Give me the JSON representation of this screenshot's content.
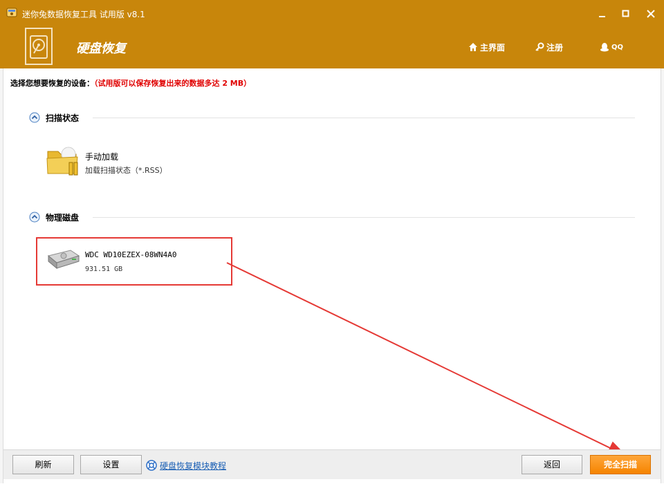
{
  "window": {
    "title": "迷你兔数据恢复工具 试用版 v8.1"
  },
  "header": {
    "title": "硬盘恢复",
    "nav": {
      "home": "主界面",
      "register": "注册",
      "qq": "QQ"
    }
  },
  "prompt": {
    "text": "选择您想要恢复的设备：",
    "note": "（试用版可以保存恢复出来的数据多达 2 MB）"
  },
  "scan_state": {
    "label": "扫描状态",
    "items": [
      {
        "name": "手动加载",
        "sub": "加载扫描状态（*.RSS）"
      }
    ]
  },
  "physical_disks": {
    "label": "物理磁盘",
    "items": [
      {
        "name": "WDC WD10EZEX-08WN4A0",
        "sub": "931.51 GB"
      }
    ]
  },
  "footer": {
    "refresh": "刷新",
    "settings": "设置",
    "tutorial_link": "硬盘恢复模块教程",
    "back": "返回",
    "full_scan": "完全扫描"
  },
  "colors": {
    "header_bg": "#c8860b",
    "primary_button": "#f58400",
    "highlight": "#e53935",
    "link": "#1a5fb4"
  }
}
